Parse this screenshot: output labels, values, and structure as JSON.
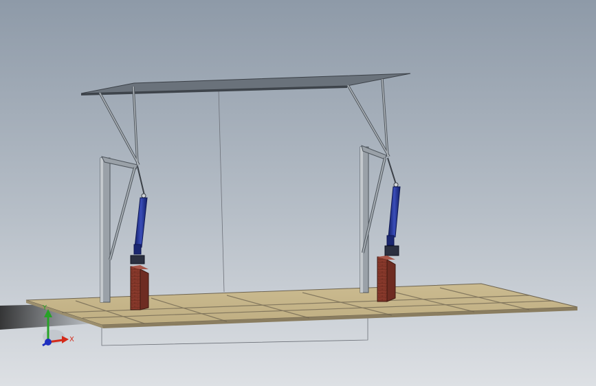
{
  "colors": {
    "bg_top": "#8e9aa8",
    "bg_bottom": "#d9dde2",
    "floor": "#c9b88e",
    "floor_edge": "#6e6450",
    "steel": "#9aa1a8",
    "steel_dark": "#4e555c",
    "actuator": "#1f2f8a",
    "brick": "#8a3a2c",
    "axis_x": "#d42a1a",
    "axis_y": "#27a227",
    "axis_z": "#1f2fbf"
  },
  "triad": {
    "x_label": "X",
    "y_label": "Y"
  }
}
